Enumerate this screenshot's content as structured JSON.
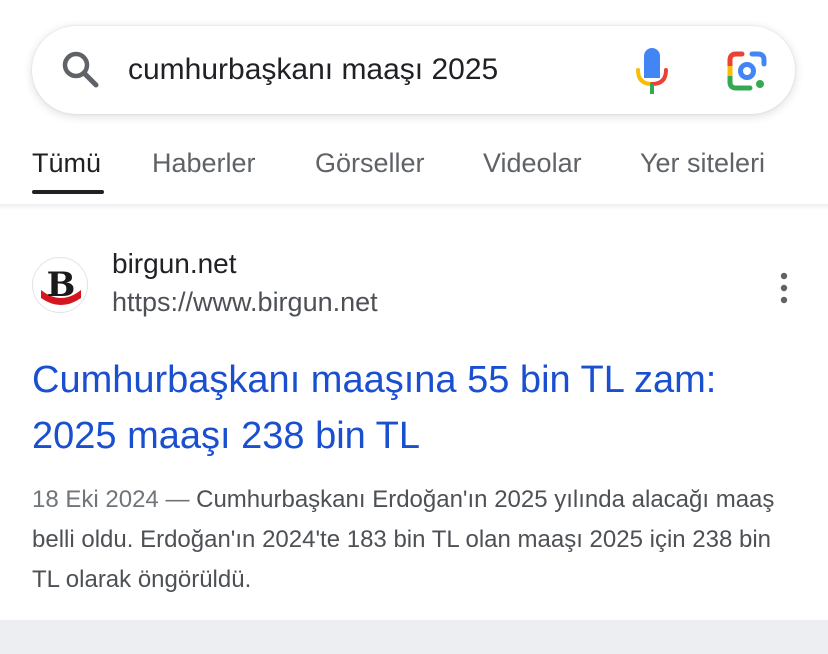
{
  "search": {
    "query": "cumhurbaşkanı maaşı 2025"
  },
  "tabs": [
    {
      "label": "Tümü",
      "active": true
    },
    {
      "label": "Haberler",
      "active": false
    },
    {
      "label": "Görseller",
      "active": false
    },
    {
      "label": "Videolar",
      "active": false
    },
    {
      "label": "Yer siteleri",
      "active": false
    }
  ],
  "result": {
    "favicon_letter": "B",
    "site_name": "birgun.net",
    "site_url": "https://www.birgun.net",
    "title": "Cumhurbaşkanı maaşına 55 bin TL zam: 2025 maaşı 238 bin TL",
    "date": "18 Eki 2024",
    "separator": "—",
    "snippet": "Cumhurbaşkanı Erdoğan'ın 2025 yılında alacağı maaş belli oldu. Erdoğan'ın 2024'te 183 bin TL olan maaşı 2025 için 238 bin TL olarak öngörüldü."
  },
  "icons": {
    "search": "search-icon",
    "mic": "mic-icon",
    "lens": "google-lens-icon",
    "more": "more-vert-icon"
  },
  "colors": {
    "link": "#1a4fd0",
    "text": "#202124",
    "muted": "#4d5156",
    "tab_inactive": "#5f6368"
  }
}
